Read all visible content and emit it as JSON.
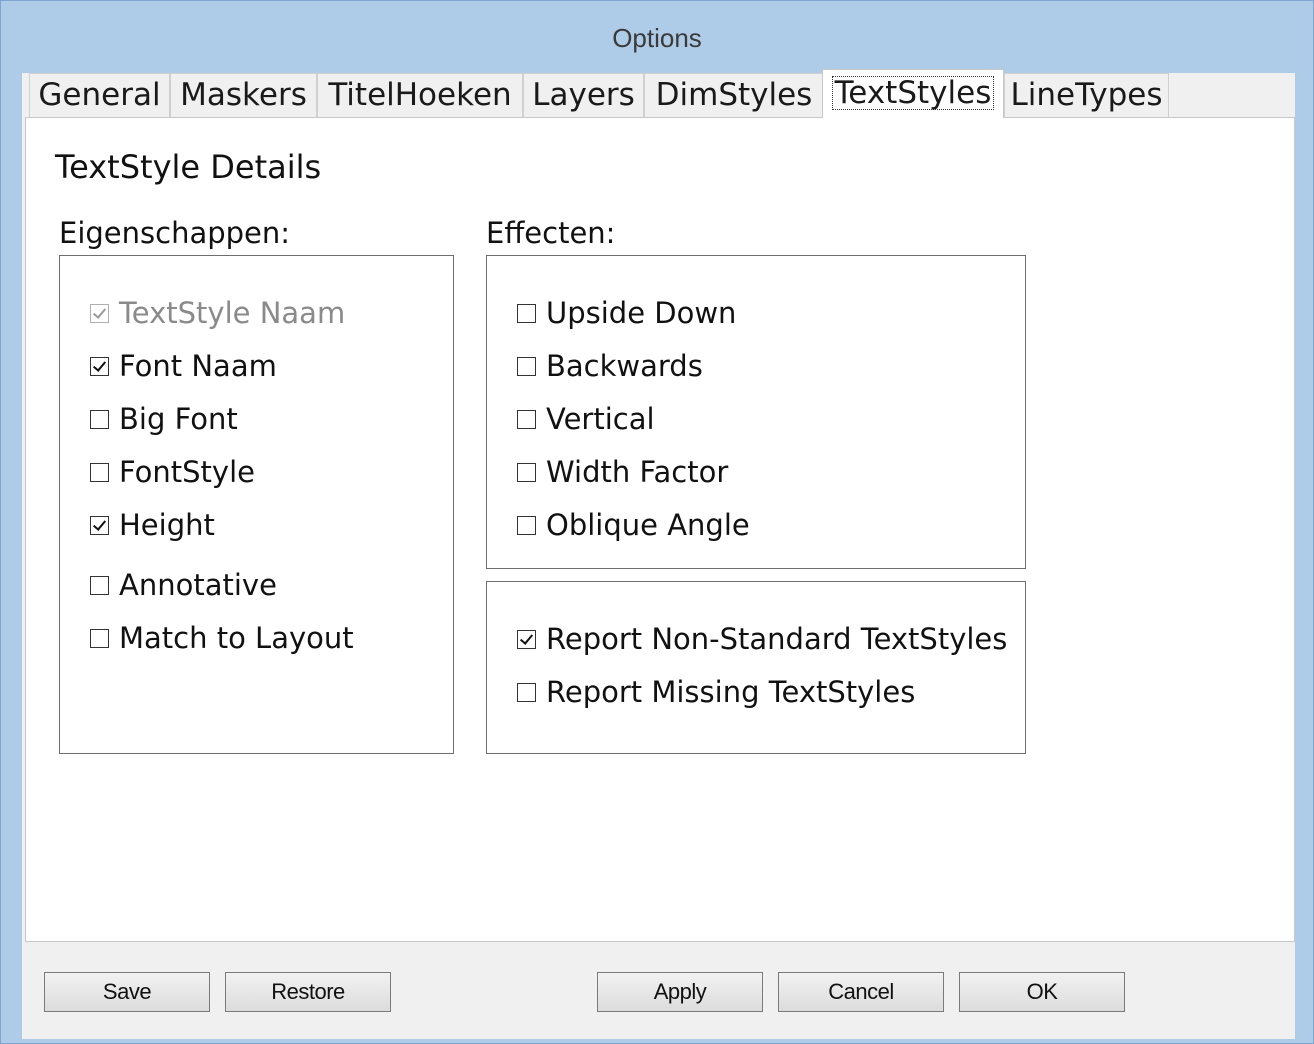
{
  "window": {
    "title": "Options"
  },
  "tabs": [
    {
      "label": "General",
      "active": false
    },
    {
      "label": "Maskers",
      "active": false
    },
    {
      "label": "TitelHoeken",
      "active": false
    },
    {
      "label": "Layers",
      "active": false
    },
    {
      "label": "DimStyles",
      "active": false
    },
    {
      "label": "TextStyles",
      "active": true
    },
    {
      "label": "LineTypes",
      "active": false
    }
  ],
  "panel": {
    "heading": "TextStyle Details",
    "properties": {
      "label": "Eigenschappen:",
      "items": [
        {
          "label": "TextStyle Naam",
          "checked": true,
          "disabled": true
        },
        {
          "label": "Font Naam",
          "checked": true,
          "disabled": false
        },
        {
          "label": "Big Font",
          "checked": false,
          "disabled": false
        },
        {
          "label": "FontStyle",
          "checked": false,
          "disabled": false
        },
        {
          "label": "Height",
          "checked": true,
          "disabled": false
        },
        {
          "label": "Annotative",
          "checked": false,
          "disabled": false
        },
        {
          "label": "Match to Layout",
          "checked": false,
          "disabled": false
        }
      ]
    },
    "effects": {
      "label": "Effecten:",
      "items": [
        {
          "label": "Upside Down",
          "checked": false
        },
        {
          "label": "Backwards",
          "checked": false
        },
        {
          "label": "Vertical",
          "checked": false
        },
        {
          "label": "Width Factor",
          "checked": false
        },
        {
          "label": "Oblique Angle",
          "checked": false
        }
      ]
    },
    "report": {
      "items": [
        {
          "label": "Report Non-Standard TextStyles",
          "checked": true
        },
        {
          "label": "Report Missing TextStyles",
          "checked": false
        }
      ]
    }
  },
  "buttons": {
    "save": "Save",
    "restore": "Restore",
    "apply": "Apply",
    "cancel": "Cancel",
    "ok": "OK"
  }
}
